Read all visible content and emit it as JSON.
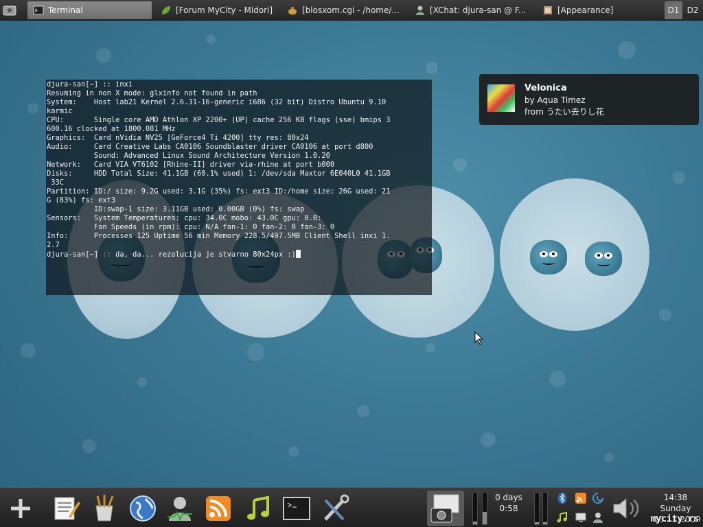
{
  "top_panel": {
    "tasks": [
      {
        "label": "Terminal",
        "icon": "terminal-icon",
        "active": true
      },
      {
        "label": "[Forum MyCity - Midori]",
        "icon": "midori-leaf-icon"
      },
      {
        "label": "[blosxom.cgi - /home/...",
        "icon": "editor-teapot-icon"
      },
      {
        "label": "[XChat: djura-san @ F...",
        "icon": "xchat-person-icon"
      },
      {
        "label": "[Appearance]",
        "icon": "appearance-icon"
      }
    ],
    "workspaces": [
      "D1",
      "D2"
    ],
    "active_workspace": "D1"
  },
  "terminal": {
    "lines": [
      "djura-san[~] :: inxi",
      "Resuming in non X mode: glxinfo not found in path",
      "System:    Host lab21 Kernel 2.6.31-16-generic i686 (32 bit) Distro Ubuntu 9.10",
      "karmic",
      "CPU:       Single core AMD Athlon XP 2200+ (UP) cache 256 KB flags (sse) bmips 3",
      "600.16 clocked at 1800.081 MHz",
      "Graphics:  Card nVidia NV25 [GeForce4 Ti 4200] tty res: 80x24",
      "Audio:     Card Creative Labs CA0106 Soundblaster driver CA0106 at port d800",
      "           Sound: Advanced Linux Sound Architecture Version 1.0.20",
      "Network:   Card VIA VT6102 [Rhine-II] driver via-rhine at port b000",
      "Disks:     HDD Total Size: 41.1GB (60.1% used) 1: /dev/sda Maxtor 6E040L0 41.1GB",
      " 33C",
      "Partition: ID:/ size: 9.2G used: 3.1G (35%) fs: ext3 ID:/home size: 26G used: 21",
      "G (83%) fs: ext3",
      "           ID:swap-1 size: 3.11GB used: 0.00GB (0%) fs: swap",
      "Sensors:   System Temperatures: cpu: 34.0C mobo: 43.0C gpu: 0.0:",
      "           Fan Speeds (in rpm): cpu: N/A fan-1: 0 fan-2: 0 fan-3: 0",
      "Info:      Processes 125 Uptime 56 min Memory 228.5/497.5MB Client Shell inxi 1.",
      "2.7"
    ],
    "prompt_prefix": "djura-san[~] ",
    "prompt_marker": "::",
    "prompt_text": " da, da... rezolucija je stvarno 80x24px :)"
  },
  "notification": {
    "title": "Velonica",
    "by": "by Aqua Timez",
    "from": "from うたい去りし花",
    "icon": "album-art-icon"
  },
  "bottom_panel": {
    "launchers": [
      "add-icon",
      "text-editor-icon",
      "graphics-brush-icon",
      "web-browser-globe-icon",
      "instant-messenger-icon",
      "rss-feed-icon",
      "music-player-icon",
      "terminal-icon",
      "settings-tools-icon"
    ],
    "uptime": {
      "days": "0 days",
      "time": "0:58"
    },
    "clock": {
      "time": "14:38",
      "day": "Sunday",
      "date": "13.12.2009"
    },
    "volume_level": 0.35,
    "watermark": "mycity.rs"
  }
}
